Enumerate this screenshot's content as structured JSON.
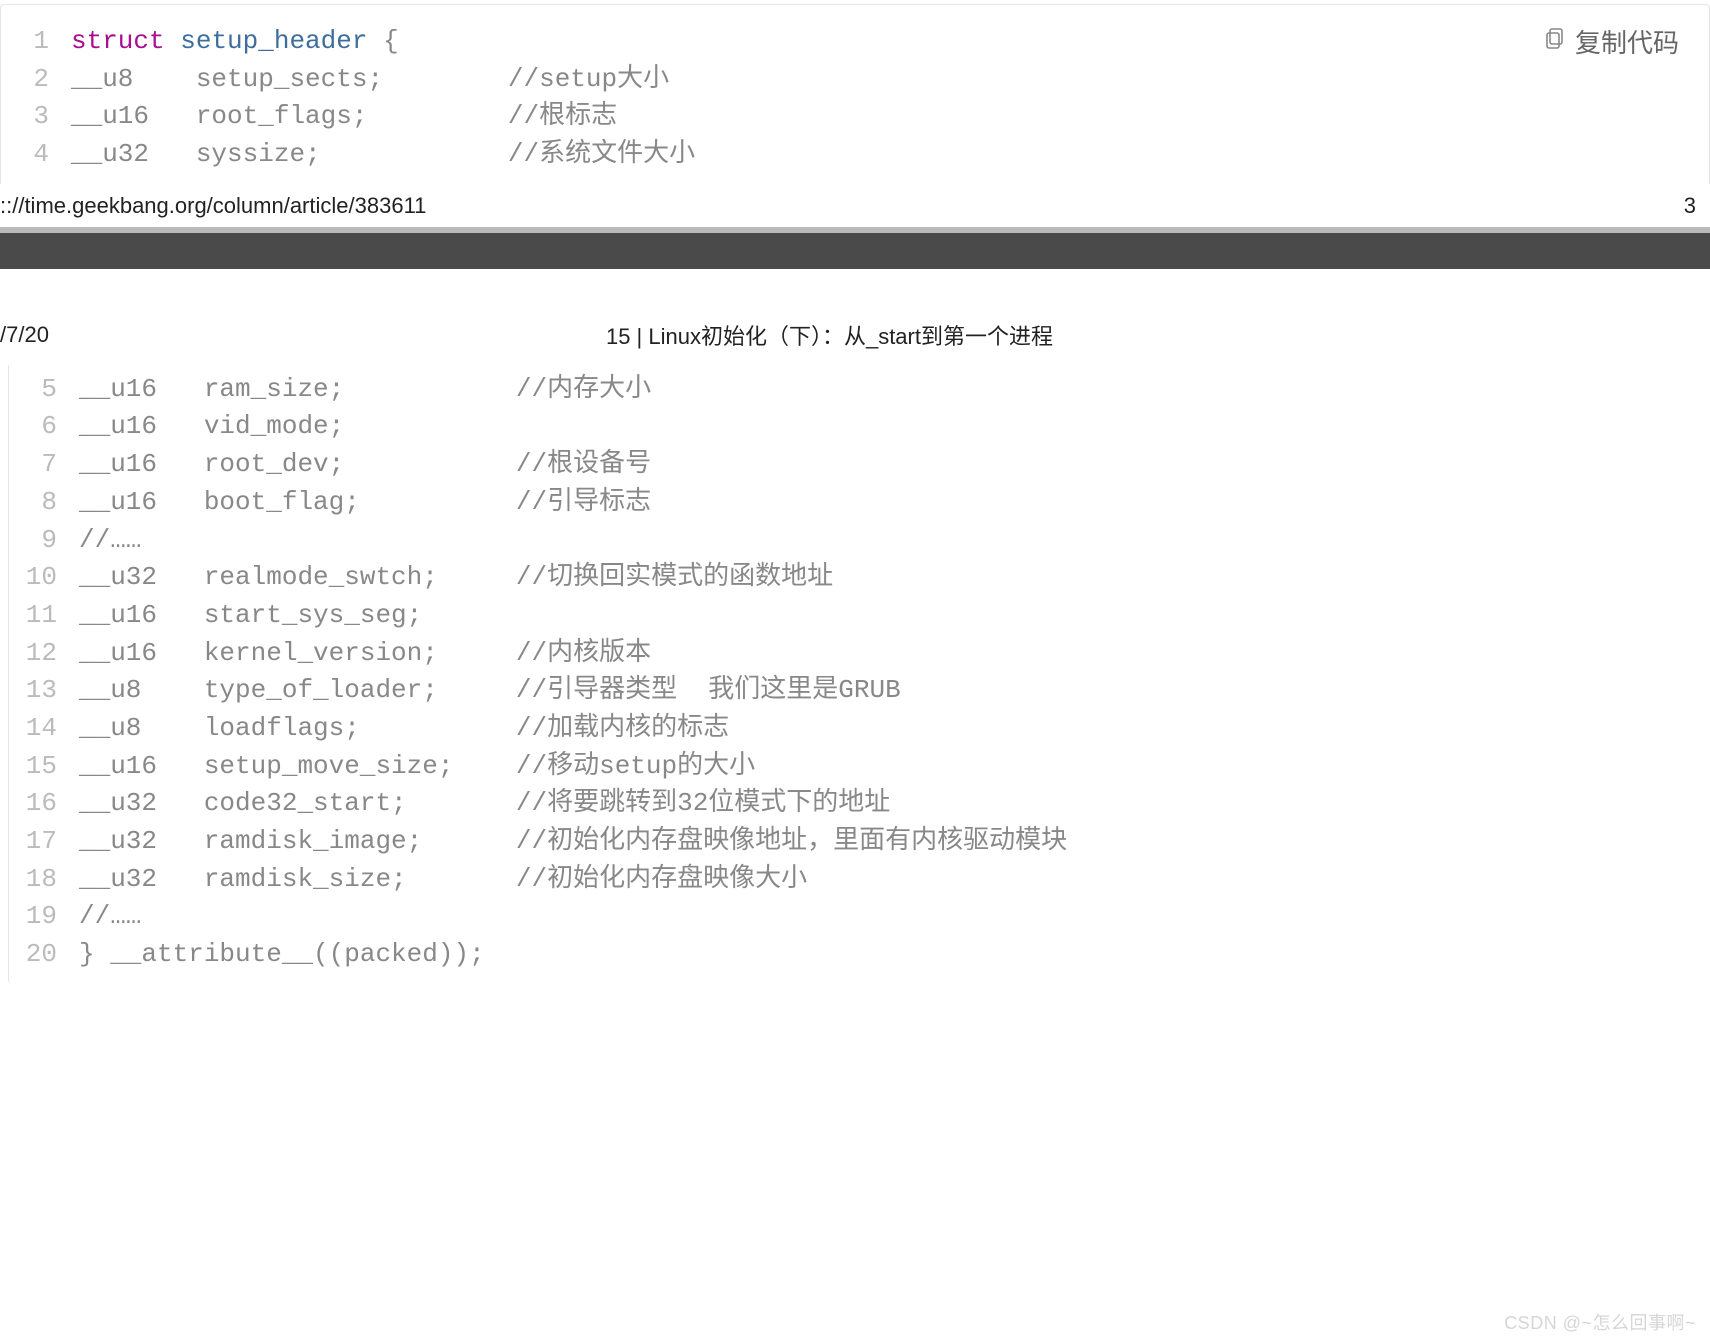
{
  "copy_label": "复制代码",
  "url_text": ":://time.geekbang.org/column/article/383611",
  "url_page_right": "3",
  "page2_date": "/7/20",
  "page2_title": "15 | Linux初始化（下）：从_start到第一个进程",
  "watermark": "CSDN @~怎么回事啊~",
  "code_top": {
    "lines": [
      {
        "n": "1",
        "pre": "",
        "kw": "struct",
        "space": " ",
        "name": "setup_header",
        "rest": " {"
      },
      {
        "n": "2",
        "type": "__u8",
        "field": "setup_sects;",
        "cmt": "//setup大小"
      },
      {
        "n": "3",
        "type": "__u16",
        "field": "root_flags;",
        "cmt": "//根标志"
      },
      {
        "n": "4",
        "type": "__u32",
        "field": "syssize;",
        "cmt": "//系统文件大小"
      }
    ]
  },
  "code_bottom": {
    "lines": [
      {
        "n": "5",
        "type": "__u16",
        "field": "ram_size;",
        "cmt": "//内存大小"
      },
      {
        "n": "6",
        "type": "__u16",
        "field": "vid_mode;",
        "cmt": ""
      },
      {
        "n": "7",
        "type": "__u16",
        "field": "root_dev;",
        "cmt": "//根设备号"
      },
      {
        "n": "8",
        "type": "__u16",
        "field": "boot_flag;",
        "cmt": "//引导标志"
      },
      {
        "n": "9",
        "raw": "//……"
      },
      {
        "n": "10",
        "type": "__u32",
        "field": "realmode_swtch;",
        "cmt": "//切换回实模式的函数地址"
      },
      {
        "n": "11",
        "type": "__u16",
        "field": "start_sys_seg;",
        "cmt": ""
      },
      {
        "n": "12",
        "type": "__u16",
        "field": "kernel_version;",
        "cmt": "//内核版本"
      },
      {
        "n": "13",
        "type": "__u8",
        "field": "type_of_loader;",
        "cmt": "//引导器类型  我们这里是GRUB"
      },
      {
        "n": "14",
        "type": "__u8",
        "field": "loadflags;",
        "cmt": "//加载内核的标志"
      },
      {
        "n": "15",
        "type": "__u16",
        "field": "setup_move_size;",
        "cmt": "//移动setup的大小"
      },
      {
        "n": "16",
        "type": "__u32",
        "field": "code32_start;",
        "cmt": "//将要跳转到32位模式下的地址"
      },
      {
        "n": "17",
        "type": "__u32",
        "field": "ramdisk_image;",
        "cmt": "//初始化内存盘映像地址，里面有内核驱动模块"
      },
      {
        "n": "18",
        "type": "__u32",
        "field": "ramdisk_size;",
        "cmt": "//初始化内存盘映像大小"
      },
      {
        "n": "19",
        "raw": "//……"
      },
      {
        "n": "20",
        "raw": "} __attribute__((packed));"
      }
    ]
  },
  "columns": {
    "type_pad": 8,
    "field_pad": 20
  }
}
